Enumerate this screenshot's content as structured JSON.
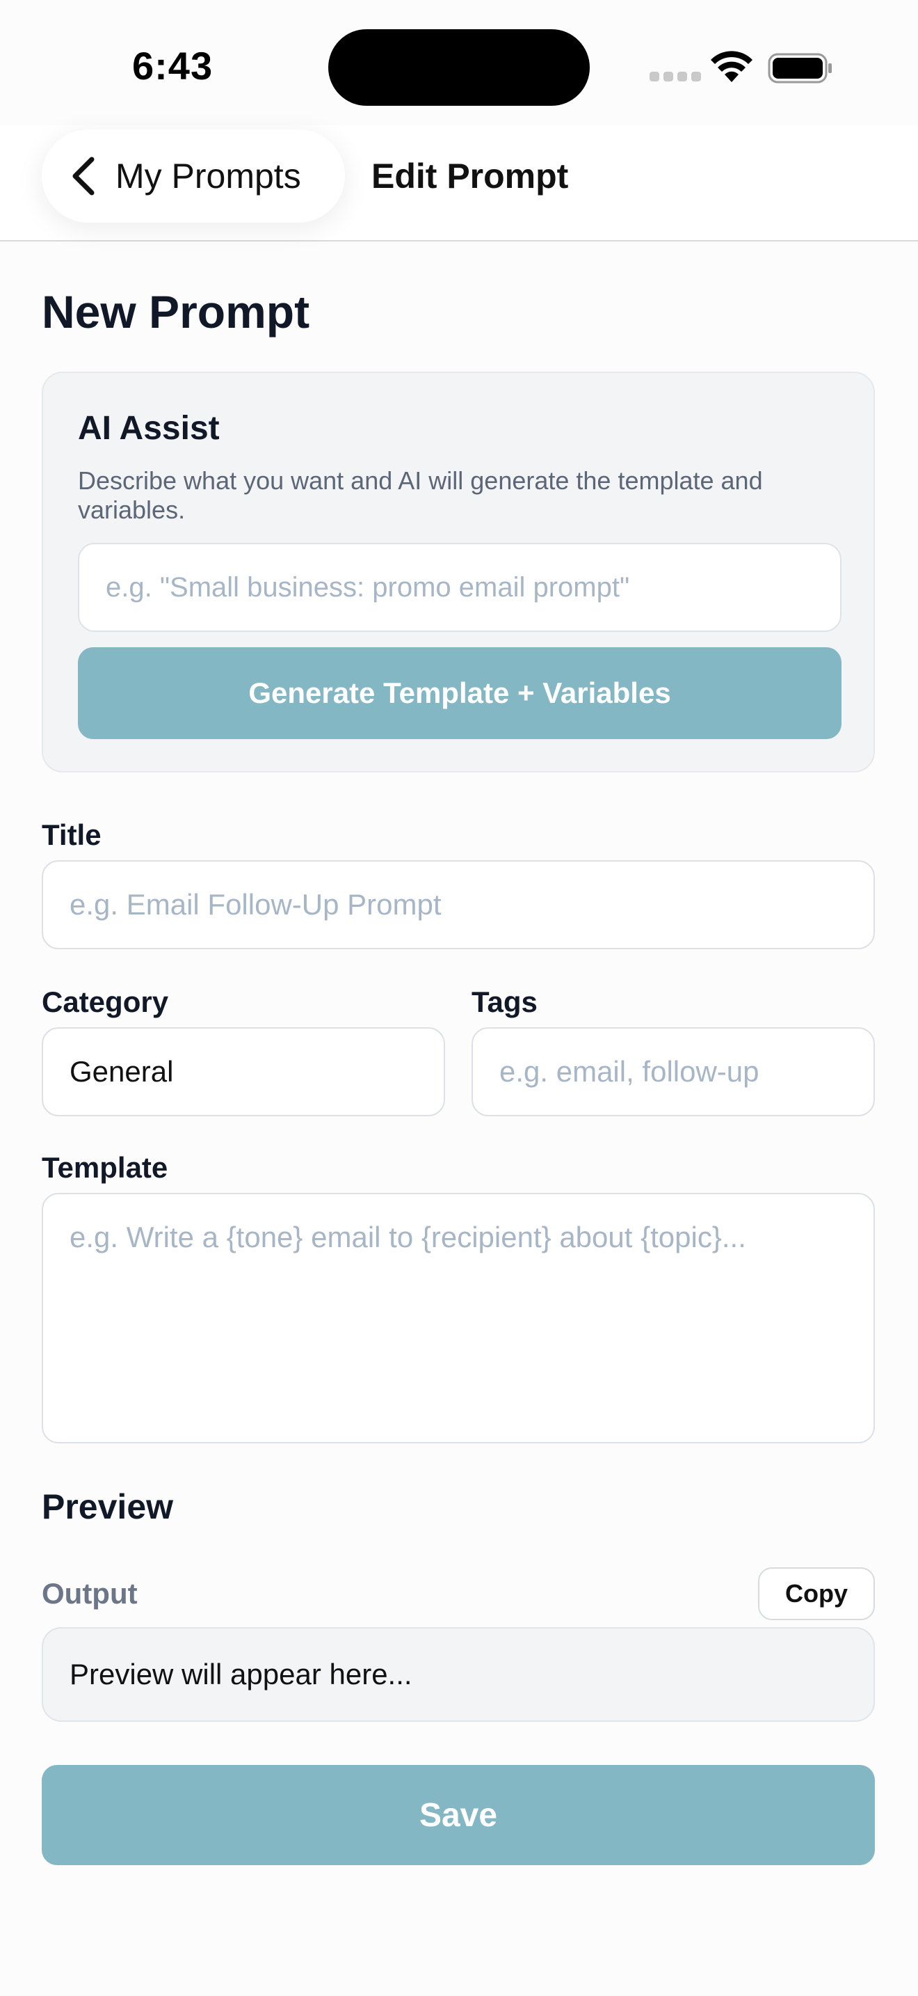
{
  "status_bar": {
    "time": "6:43"
  },
  "nav": {
    "back_label": "My Prompts",
    "title": "Edit Prompt"
  },
  "page": {
    "title": "New Prompt"
  },
  "ai_assist": {
    "title": "AI Assist",
    "description": "Describe what you want and AI will generate the template and variables.",
    "placeholder": "e.g. \"Small business: promo email prompt\"",
    "value": "",
    "generate_label": "Generate Template + Variables"
  },
  "form": {
    "title_label": "Title",
    "title_placeholder": "e.g. Email Follow-Up Prompt",
    "category_label": "Category",
    "category_value": "General",
    "tags_label": "Tags",
    "tags_placeholder": "e.g. email, follow-up",
    "template_label": "Template",
    "template_placeholder": "e.g. Write a {tone} email to {recipient} about {topic}..."
  },
  "preview": {
    "heading": "Preview",
    "output_label": "Output",
    "copy_label": "Copy",
    "output_text": "Preview will appear here..."
  },
  "actions": {
    "save_label": "Save"
  },
  "colors": {
    "accent_button": "#84b7c4",
    "card_bg": "#f3f4f6",
    "placeholder": "#a7b6c6"
  }
}
